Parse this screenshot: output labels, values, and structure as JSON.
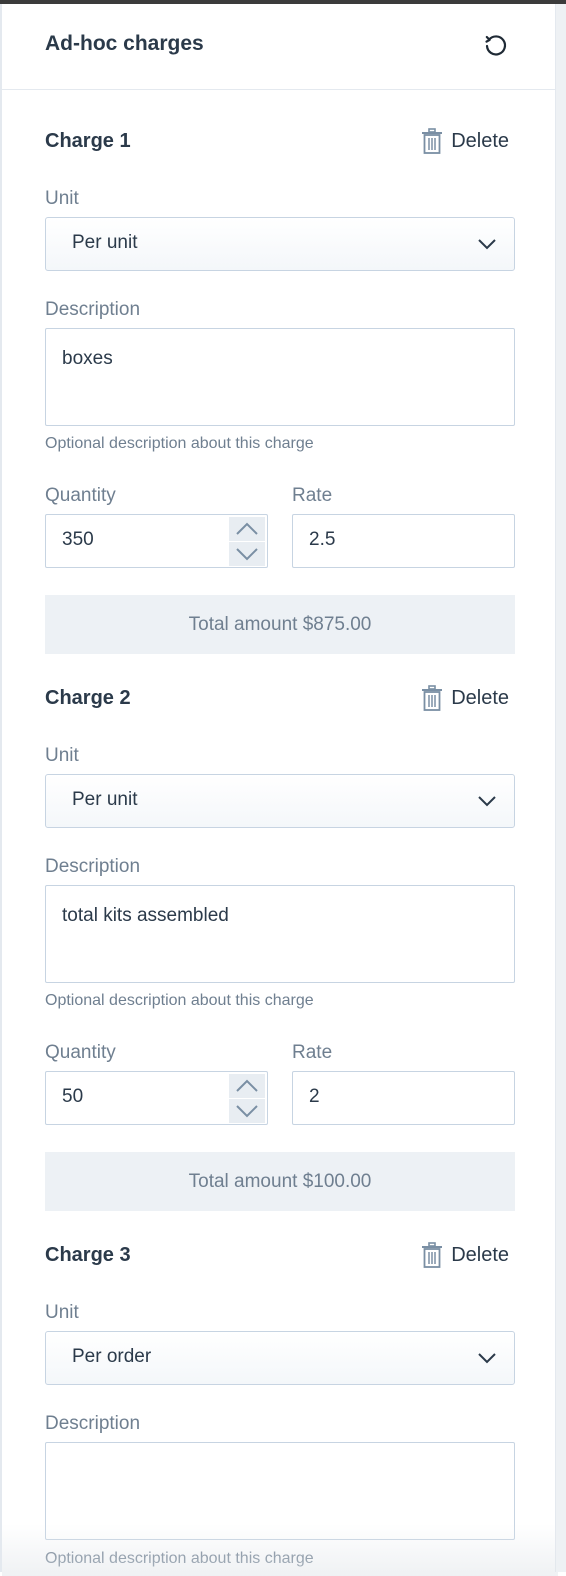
{
  "header": {
    "title": "Ad-hoc charges",
    "refresh_icon": "refresh-icon"
  },
  "labels": {
    "unit": "Unit",
    "description": "Description",
    "hint": "Optional description about this charge",
    "quantity": "Quantity",
    "rate": "Rate",
    "delete": "Delete"
  },
  "charges": [
    {
      "title": "Charge 1",
      "unit": "Per unit",
      "description": "boxes",
      "quantity": "350",
      "rate": "2.5",
      "total": "Total amount $875.00"
    },
    {
      "title": "Charge 2",
      "unit": "Per unit",
      "description": "total kits assembled",
      "quantity": "50",
      "rate": "2",
      "total": "Total amount $100.00"
    },
    {
      "title": "Charge 3",
      "unit": "Per order",
      "description": ""
    }
  ],
  "colors": {
    "text": "#2b3a4a",
    "muted": "#6f7f90",
    "border": "#c7d4e2",
    "total_bg": "#edf1f5",
    "icon": "#7a8fa4"
  }
}
